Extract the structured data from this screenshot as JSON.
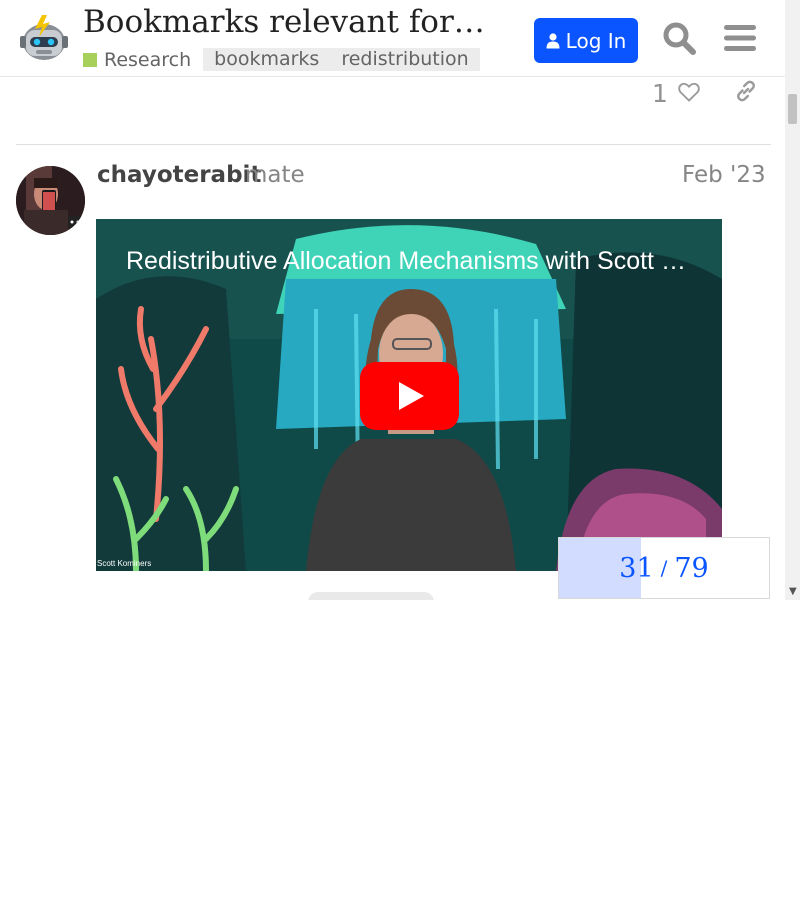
{
  "header": {
    "title": "Bookmarks relevant for redistribution",
    "category": {
      "name": "Research",
      "color": "#a6d05a"
    },
    "tags": [
      "bookmarks",
      "redistribution"
    ],
    "login_label": "Log In",
    "accent": "#0a55ff"
  },
  "prev_post": {
    "like_count": "1"
  },
  "post": {
    "username": "chayoterabit",
    "user_title": "mate",
    "date": "Feb '23",
    "video": {
      "title": "Redistributive Allocation Mechanisms with Scott Kominers",
      "credit": "Scott Kominers"
    }
  },
  "timeline": {
    "current": "31",
    "separator": "/",
    "total": "79",
    "fraction": 0.392
  }
}
